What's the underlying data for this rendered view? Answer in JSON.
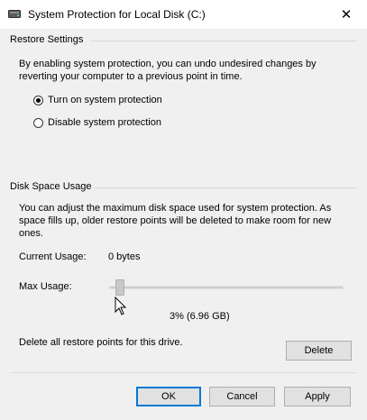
{
  "window": {
    "title": "System Protection for Local Disk (C:)",
    "close_glyph": "✕",
    "icon": "drive-icon"
  },
  "restore_settings": {
    "header": "Restore Settings",
    "description": "By enabling system protection, you can undo undesired changes by reverting your computer to a previous point in time.",
    "options": [
      {
        "label": "Turn on system protection",
        "selected": true
      },
      {
        "label": "Disable system protection",
        "selected": false
      }
    ]
  },
  "disk_space": {
    "header": "Disk Space Usage",
    "description": "You can adjust the maximum disk space used for system protection. As space fills up, older restore points will be deleted to make room for new ones.",
    "current_usage_label": "Current Usage:",
    "current_usage_value": "0 bytes",
    "max_usage_label": "Max Usage:",
    "max_usage_percent": 3,
    "max_usage_display": "3% (6.96 GB)",
    "delete_text": "Delete all restore points for this drive.",
    "delete_label": "Delete"
  },
  "buttons": {
    "ok": "OK",
    "cancel": "Cancel",
    "apply": "Apply"
  },
  "colors": {
    "accent": "#0078d7",
    "background": "#f0f0f0"
  }
}
